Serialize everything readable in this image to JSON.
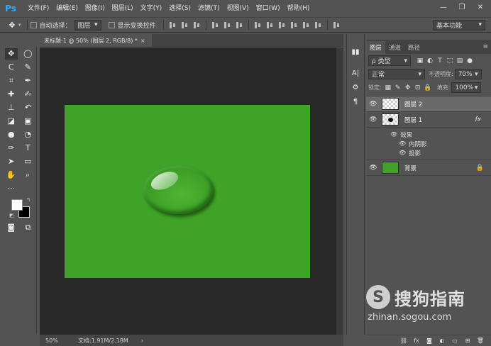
{
  "app": {
    "logo": "Ps",
    "menu": [
      "文件(F)",
      "编辑(E)",
      "图像(I)",
      "图层(L)",
      "文字(Y)",
      "选择(S)",
      "滤镜(T)",
      "视图(V)",
      "窗口(W)",
      "帮助(H)"
    ],
    "window_controls": [
      "—",
      "❐",
      "✕"
    ]
  },
  "options": {
    "auto_select_label": "自动选择：",
    "auto_select_value": "图层",
    "show_transform_label": "显示变换控件",
    "workspace": "基本功能"
  },
  "document": {
    "tab_title": "未标题-1 @ 50% (图层 2, RGB/8) *",
    "tab_close": "×",
    "canvas_color": "#3ea326"
  },
  "status": {
    "zoom": "50%",
    "doc_size": "文档:1.91M/2.18M",
    "arrow": "›"
  },
  "layers_panel": {
    "tabs": [
      "图层",
      "通道",
      "路径"
    ],
    "menu_icon": "≡",
    "filter_kind": "ρ 类型",
    "blend_mode": "正常",
    "opacity_label": "不透明度:",
    "opacity_value": "70%",
    "lock_label": "锁定:",
    "fill_label": "填充:",
    "fill_value": "100%",
    "layers": [
      {
        "name": "图层 2",
        "selected": true
      },
      {
        "name": "图层 1",
        "fx": "fx"
      },
      {
        "name": "背景",
        "locked": true
      }
    ],
    "effects_label": "效果",
    "effects": [
      "内阴影",
      "投影"
    ]
  },
  "watermark": {
    "logo_letter": "S",
    "title": "搜狗指南",
    "url": "zhinan.sogou.com"
  }
}
